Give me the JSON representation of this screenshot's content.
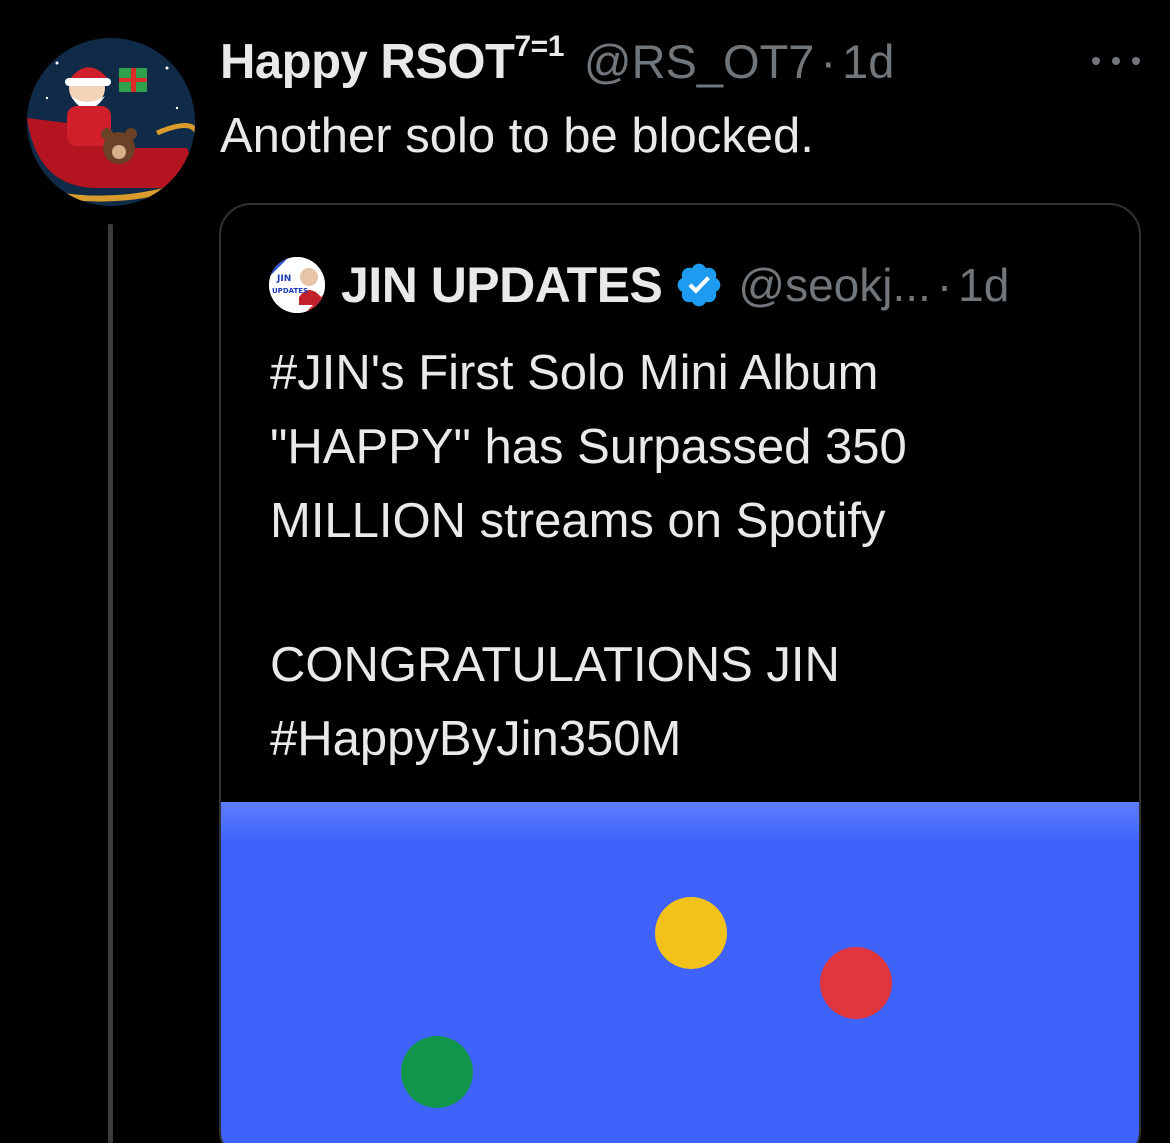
{
  "tweet": {
    "author": {
      "display_name": "Happy RSOT",
      "name_superscript": "7=1",
      "handle": "@RS_OT7",
      "separator": "·",
      "time": "1d"
    },
    "text": "Another solo to be blocked."
  },
  "quote": {
    "author": {
      "display_name": "JIN UPDATES",
      "avatar_text_top": "JIN",
      "avatar_text_bottom": "UPDATES",
      "verified": true,
      "handle": "@seokj...",
      "separator": "·",
      "time": "1d"
    },
    "lines": [
      "#JIN's First Solo Mini Album",
      "\"HAPPY\" has Surpassed 350",
      "MILLION streams on Spotify",
      "CONGRATULATIONS JIN",
      "#HappyByJin350M"
    ],
    "media": {
      "background_color": "#3f62fb",
      "dots": [
        "yellow",
        "red",
        "green"
      ]
    }
  },
  "colors": {
    "background": "#000000",
    "text": "#e7e9ea",
    "muted": "#71767b",
    "verified": "#1d9bf0"
  },
  "icons": [
    "more-icon",
    "verified-badge-icon"
  ]
}
